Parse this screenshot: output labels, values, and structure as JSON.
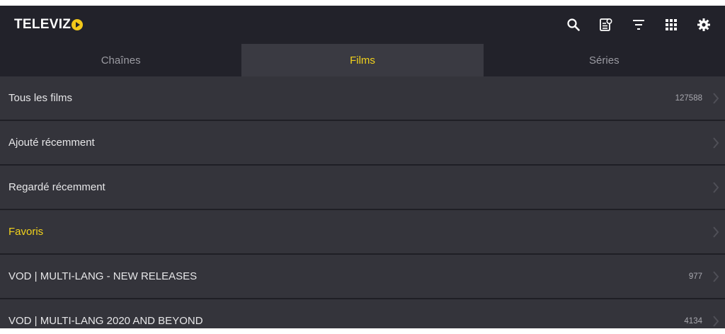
{
  "app": {
    "logo_text": "TELEVIZ",
    "logo_color": "#f2c81a"
  },
  "toolbar": {
    "icons": [
      "search-icon",
      "epg-icon",
      "filter-icon",
      "grid-icon",
      "settings-icon"
    ]
  },
  "tabs": [
    {
      "label": "Chaînes",
      "active": false
    },
    {
      "label": "Films",
      "active": true
    },
    {
      "label": "Séries",
      "active": false
    }
  ],
  "rows": [
    {
      "label": "Tous les films",
      "count": "127588"
    },
    {
      "label": "Ajouté récemment",
      "count": ""
    },
    {
      "label": "Regardé récemment",
      "count": ""
    },
    {
      "label": "Favoris",
      "count": ""
    },
    {
      "label": "VOD | MULTI-LANG - NEW RELEASES",
      "count": "977"
    },
    {
      "label": "VOD | MULTI-LANG 2020 AND BEYOND",
      "count": "4134"
    }
  ],
  "colors": {
    "accent": "#f2d21c",
    "background": "#2b2b31",
    "row": "#34343b"
  }
}
